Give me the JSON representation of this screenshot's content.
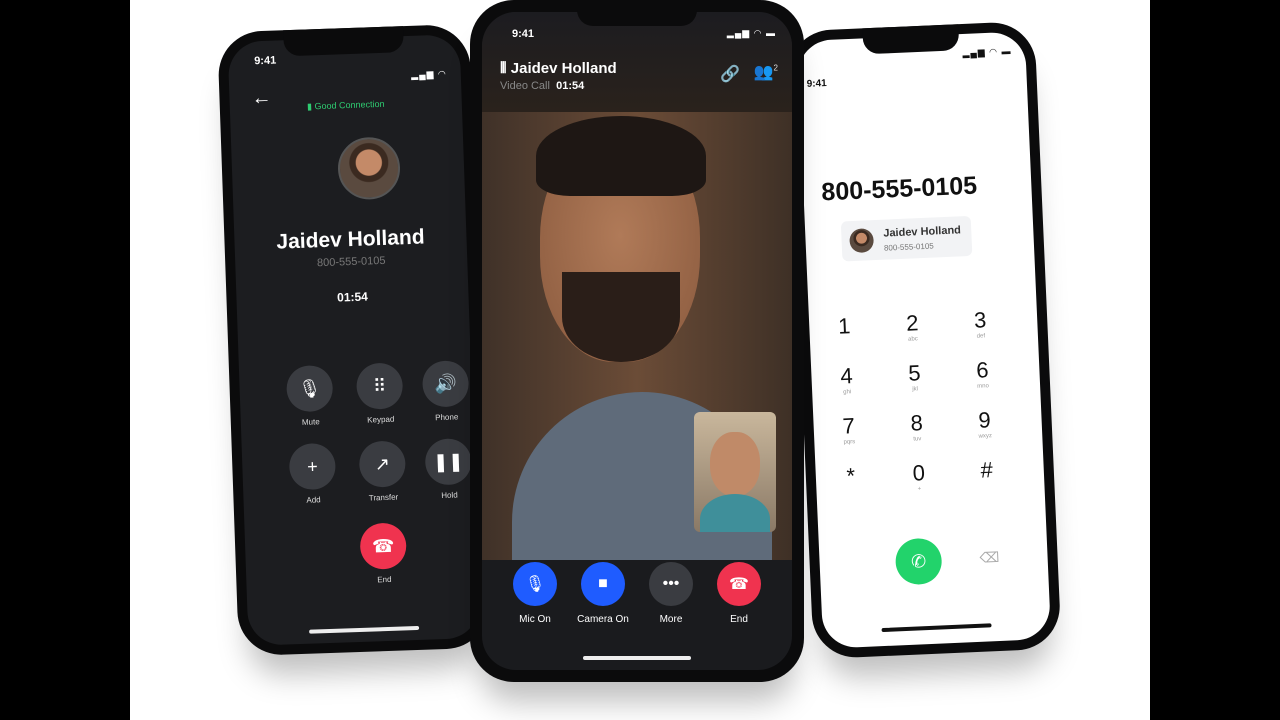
{
  "left_phone": {
    "status_time": "9:41",
    "connection": "Good Connection",
    "contact_name": "Jaidev Holland",
    "contact_number": "800-555-0105",
    "duration": "01:54",
    "controls": [
      {
        "label": "Mute",
        "icon": "microphone-icon",
        "glyph": "🎙"
      },
      {
        "label": "Keypad",
        "icon": "keypad-icon",
        "glyph": "⠿"
      },
      {
        "label": "Phone",
        "icon": "speaker-icon",
        "glyph": "🔊"
      },
      {
        "label": "Add",
        "icon": "plus-icon",
        "glyph": "+"
      },
      {
        "label": "Transfer",
        "icon": "transfer-icon",
        "glyph": "↗"
      },
      {
        "label": "Hold",
        "icon": "pause-icon",
        "glyph": "❚❚"
      }
    ],
    "end_label": "End"
  },
  "center_phone": {
    "status_time": "9:41",
    "contact_name": "Jaidev Holland",
    "call_type": "Video Call",
    "duration": "01:54",
    "participants_count": "2",
    "controls": [
      {
        "label": "Mic On",
        "icon": "microphone-icon",
        "glyph": "🎙",
        "color": "#1f5cff"
      },
      {
        "label": "Camera On",
        "icon": "video-camera-icon",
        "glyph": "■",
        "color": "#1f5cff"
      },
      {
        "label": "More",
        "icon": "more-icon",
        "glyph": "•••",
        "color": "#3a3c41"
      },
      {
        "label": "End",
        "icon": "end-call-icon",
        "glyph": "☎",
        "color": "#f0334f"
      }
    ]
  },
  "right_phone": {
    "status_time": "9:41",
    "dialed_number": "800-555-0105",
    "suggestion": {
      "name": "Jaidev Holland",
      "number": "800-555-0105"
    },
    "keys": [
      {
        "digit": "1",
        "letters": ""
      },
      {
        "digit": "2",
        "letters": "abc"
      },
      {
        "digit": "3",
        "letters": "def"
      },
      {
        "digit": "4",
        "letters": "ghi"
      },
      {
        "digit": "5",
        "letters": "jkl"
      },
      {
        "digit": "6",
        "letters": "mno"
      },
      {
        "digit": "7",
        "letters": "pqrs"
      },
      {
        "digit": "8",
        "letters": "tuv"
      },
      {
        "digit": "9",
        "letters": "wxyz"
      },
      {
        "digit": "*",
        "letters": ""
      },
      {
        "digit": "0",
        "letters": "+"
      },
      {
        "digit": "#",
        "letters": ""
      }
    ]
  },
  "colors": {
    "accent_blue": "#1f5cff",
    "end_red": "#f0334f",
    "call_green": "#22d36b",
    "good_connection": "#2ecc71"
  }
}
